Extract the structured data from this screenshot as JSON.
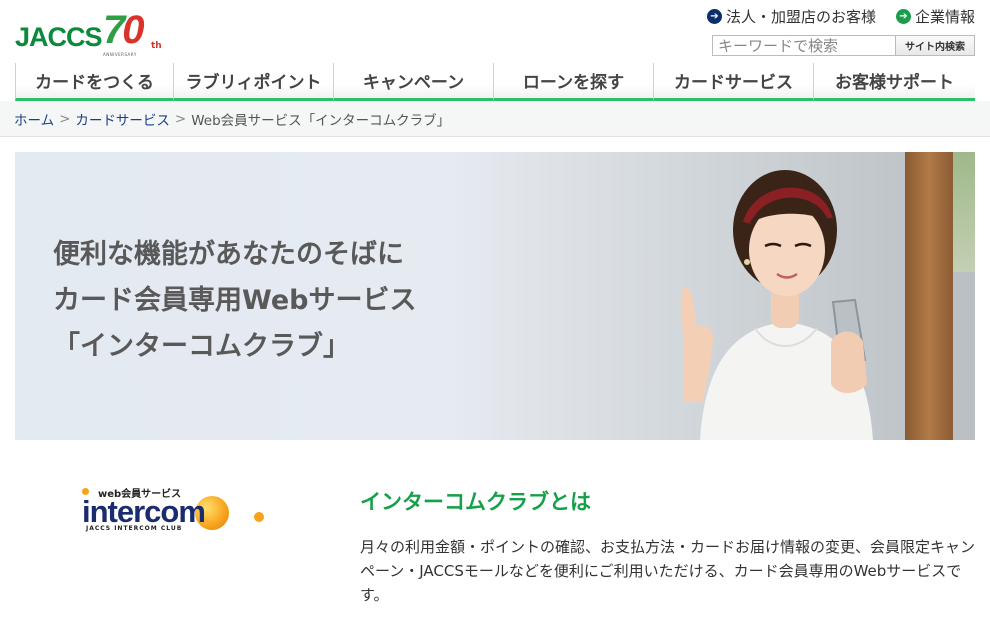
{
  "logo": {
    "brand": "JACCS",
    "number_7": "7",
    "number_0": "0",
    "suffix": "th",
    "tagline": "ANNIVERSARY"
  },
  "top_links": [
    {
      "label": "法人・加盟店のお客様",
      "icon": "arrow-right-icon",
      "color": "#0a2f6b"
    },
    {
      "label": "企業情報",
      "icon": "arrow-right-icon",
      "color": "#1b9e4b"
    }
  ],
  "search": {
    "placeholder": "キーワードで検索",
    "button_label": "サイト内検索"
  },
  "nav": {
    "tabs": [
      {
        "label": "カードをつくる"
      },
      {
        "label": "ラブリィポイント"
      },
      {
        "label": "キャンペーン"
      },
      {
        "label": "ローンを探す"
      },
      {
        "label": "カードサービス"
      },
      {
        "label": "お客様サポート"
      }
    ],
    "accent_color": "#2cbf6b"
  },
  "breadcrumb": {
    "items": [
      {
        "label": "ホーム"
      },
      {
        "label": "カードサービス"
      }
    ],
    "separator": ">",
    "current": "Web会員サービス「インターコムクラブ」"
  },
  "hero": {
    "lines": [
      "便利な機能があなたのそばに",
      "カード会員専用Webサービス",
      "「インターコムクラブ」"
    ]
  },
  "intro": {
    "logo": {
      "sub": "web会員サービス",
      "main": "intercom",
      "tag": "JACCS INTERCOM CLUB"
    },
    "title": "インターコムクラブとは",
    "body": "月々の利用金額・ポイントの確認、お支払方法・カードお届け情報の変更、会員限定キャンペーン・JACCSモールなどを便利にご利用いただける、カード会員専用のWebサービスです。",
    "title_color": "#17a04a"
  }
}
